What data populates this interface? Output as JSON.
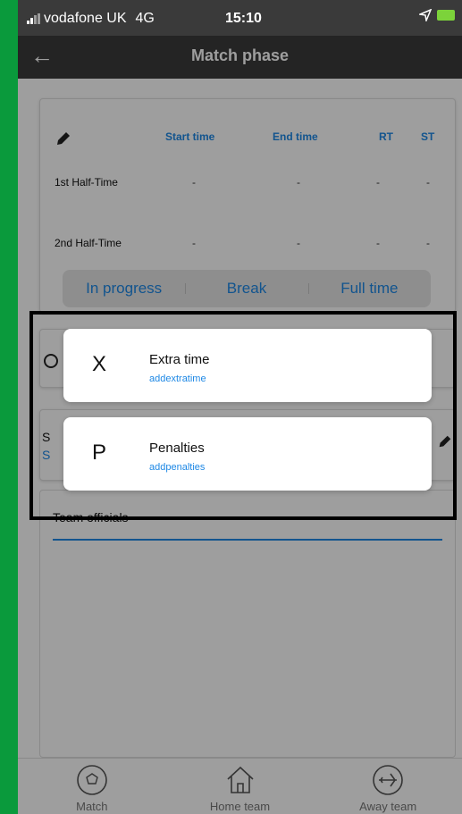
{
  "status": {
    "carrier": "vodafone UK",
    "network": "4G",
    "time": "15:10"
  },
  "appbar": {
    "back": "←",
    "title": "Match phase"
  },
  "timing": {
    "headers": {
      "start": "Start time",
      "end": "End time",
      "rt": "RT",
      "st": "ST"
    },
    "rows": [
      {
        "label": "1st Half-Time",
        "start": "-",
        "end": "-",
        "rt": "-",
        "st": "-"
      },
      {
        "label": "2nd Half-Time",
        "start": "-",
        "end": "-",
        "rt": "-",
        "st": "-"
      }
    ]
  },
  "phase": {
    "options": [
      "In progress",
      "Break",
      "Full time"
    ]
  },
  "card3": {
    "line1": "S",
    "line2": "S"
  },
  "officials": {
    "label": "Team officials"
  },
  "sheet": {
    "items": [
      {
        "letter": "X",
        "name": "Extra time",
        "code": "addextratime"
      },
      {
        "letter": "P",
        "name": "Penalties",
        "code": "addpenalties"
      }
    ]
  },
  "tabs": [
    {
      "label": "Match",
      "icon": "football-icon"
    },
    {
      "label": "Home team",
      "icon": "home-icon"
    },
    {
      "label": "Away team",
      "icon": "airplane-icon"
    }
  ],
  "colors": {
    "accent": "#1e88e5",
    "bars": "#3a3a3a",
    "side": "#0a9a3c"
  }
}
